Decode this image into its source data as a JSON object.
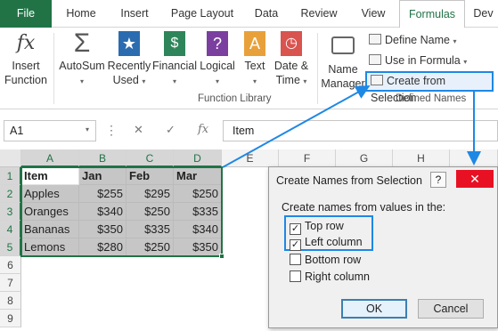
{
  "tabs": [
    "File",
    "Home",
    "Insert",
    "Page Layout",
    "Data",
    "Review",
    "View",
    "Formulas",
    "Dev"
  ],
  "ribbon": {
    "insert_function": [
      "Insert",
      "Function"
    ],
    "autosum": "AutoSum",
    "recently_used": [
      "Recently",
      "Used"
    ],
    "financial": "Financial",
    "logical": "Logical",
    "text": "Text",
    "date_time": [
      "Date &",
      "Time"
    ],
    "name_manager": [
      "Name",
      "Manager"
    ],
    "define_name": "Define Name",
    "use_in_formula": "Use in Formula",
    "create_from_selection": "Create from Selection",
    "group_function_library": "Function Library",
    "group_defined_names": "Defined Names"
  },
  "formula_bar": {
    "name_box": "A1",
    "fx": "fx",
    "content": "Item"
  },
  "columns": [
    "A",
    "B",
    "C",
    "D",
    "E",
    "F",
    "G",
    "H",
    "I"
  ],
  "rows": [
    "1",
    "2",
    "3",
    "4",
    "5",
    "6",
    "7",
    "8",
    "9"
  ],
  "table": [
    [
      "Item",
      "Jan",
      "Feb",
      "Mar"
    ],
    [
      "Apples",
      "$255",
      "$295",
      "$250"
    ],
    [
      "Oranges",
      "$340",
      "$250",
      "$335"
    ],
    [
      "Bananas",
      "$350",
      "$335",
      "$340"
    ],
    [
      "Lemons",
      "$280",
      "$250",
      "$350"
    ]
  ],
  "dialog": {
    "title": "Create Names from Selection",
    "help": "?",
    "close": "✕",
    "prompt": "Create names from values in the:",
    "options": [
      {
        "label": "Top row",
        "checked": true
      },
      {
        "label": "Left column",
        "checked": true
      },
      {
        "label": "Bottom row",
        "checked": false
      },
      {
        "label": "Right column",
        "checked": false
      }
    ],
    "ok": "OK",
    "cancel": "Cancel"
  },
  "colors": {
    "excel_green": "#217346",
    "callout_blue": "#1e88e5",
    "close_red": "#e81123"
  }
}
